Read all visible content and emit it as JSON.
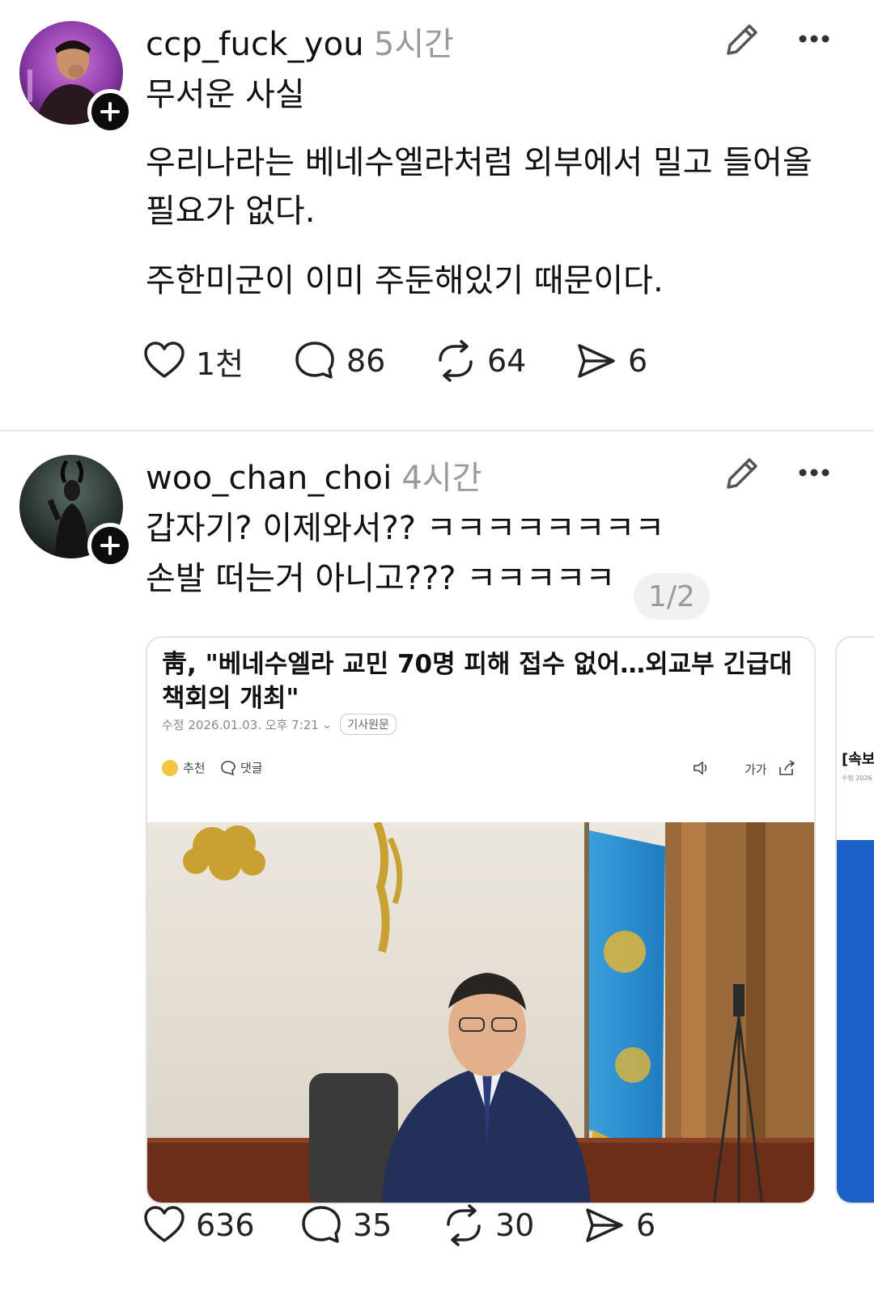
{
  "post1": {
    "username": "ccp_fuck_you",
    "time": "5시간",
    "lines": [
      "무서운 사실",
      "우리나라는 베네수엘라처럼 외부에서 밀고 들어올",
      "필요가 없다.",
      "주한미군이 이미 주둔해있기 때문이다."
    ],
    "likes": "1천",
    "comments": "86",
    "reposts": "64",
    "shares": "6"
  },
  "post2": {
    "username": "woo_chan_choi",
    "time": "4시간",
    "lines": [
      "갑자기? 이제와서?? ㅋㅋㅋㅋㅋㅋㅋㅋ",
      "손발 떠는거 아니고??? ㅋㅋㅋㅋㅋ"
    ],
    "page_indicator": "1/2",
    "card": {
      "title": "靑, \"베네수엘라 교민 70명 피해 접수 없어…외교부 긴급대책회의 개최\"",
      "meta": "수정 2026.01.03. 오후 7:21",
      "tag": "기사원문",
      "recommend": "추천",
      "comment": "댓글",
      "font_size_label": "가가"
    },
    "next_card": {
      "title": "[속보",
      "meta": "수정 2026"
    },
    "likes": "636",
    "comments": "35",
    "reposts": "30",
    "shares": "6"
  },
  "icons": {
    "edit": "pencil-icon",
    "more": "more-horizontal-icon",
    "like": "heart-icon",
    "comment": "comment-bubble-icon",
    "repost": "repost-icon",
    "share": "send-icon",
    "follow": "plus-icon"
  },
  "colors": {
    "text": "#111111",
    "muted": "#9a9a9a",
    "divider": "#e8e8e8",
    "badge": "#0c0c0c"
  }
}
